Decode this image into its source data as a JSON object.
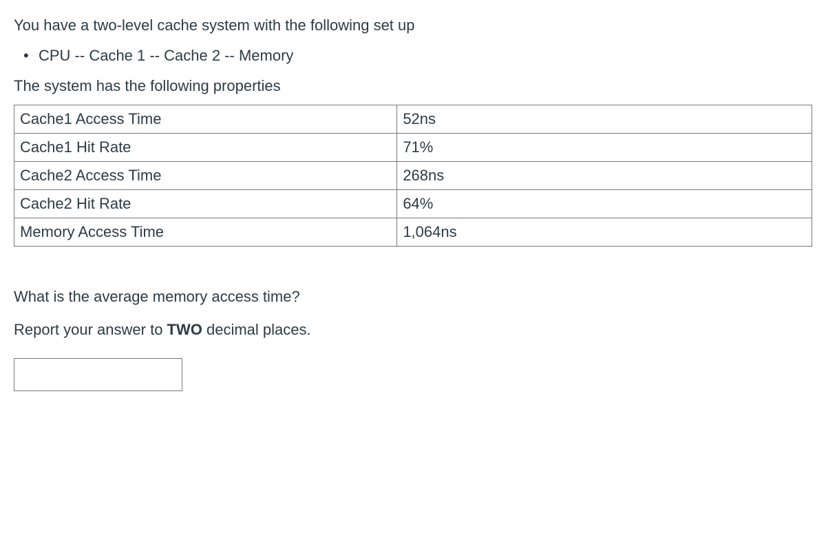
{
  "intro": "You have a two-level cache system with the following set up",
  "setup_item": "CPU -- Cache 1 -- Cache 2 -- Memory",
  "subhead": "The system has the following properties",
  "rows": [
    {
      "label": "Cache1 Access Time",
      "value": "52ns"
    },
    {
      "label": "Cache1 Hit Rate",
      "value": "71%"
    },
    {
      "label": "Cache2 Access Time",
      "value": "268ns"
    },
    {
      "label": "Cache2 Hit Rate",
      "value": "64%"
    },
    {
      "label": "Memory Access Time",
      "value": "1,064ns"
    }
  ],
  "question": "What is the average memory access time?",
  "instruction_prefix": "Report your answer to ",
  "instruction_bold": "TWO",
  "instruction_suffix": " decimal places.",
  "answer_value": ""
}
